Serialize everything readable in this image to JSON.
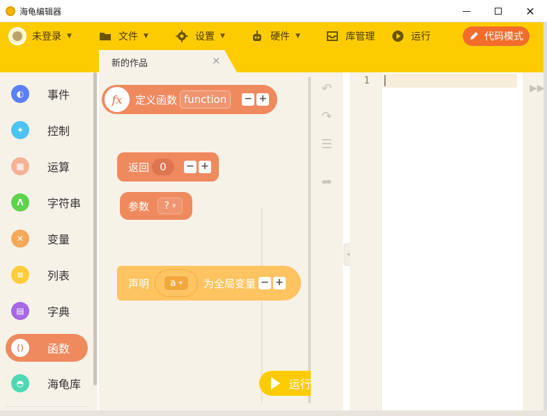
{
  "window": {
    "title": "海龟编辑器",
    "min_symbol": "",
    "close_symbol": "✕"
  },
  "menubar": {
    "user_label": "未登录",
    "file_label": "文件",
    "settings_label": "设置",
    "hardware_label": "硬件",
    "library_label": "库管理",
    "run_label": "运行",
    "code_mode_label": "代码模式"
  },
  "tab": {
    "label": "新的作品",
    "close": "×"
  },
  "sidebar": {
    "items": [
      {
        "label": "事件",
        "color": "#5b7ff7",
        "icon": "toggle-icon"
      },
      {
        "label": "控制",
        "color": "#4ec3f0",
        "icon": "gamepad-icon"
      },
      {
        "label": "运算",
        "color": "#f4b296",
        "icon": "calculator-icon"
      },
      {
        "label": "字符串",
        "color": "#5fd34f",
        "icon": "string-icon"
      },
      {
        "label": "变量",
        "color": "#f4a85a",
        "icon": "variable-icon"
      },
      {
        "label": "列表",
        "color": "#fdcc3a",
        "icon": "list-icon"
      },
      {
        "label": "字典",
        "color": "#a768e3",
        "icon": "book-icon"
      },
      {
        "label": "函数",
        "color": "#ef8a5f",
        "icon": "function-icon",
        "active": true
      },
      {
        "label": "海龟库",
        "color": "#4dd9b3",
        "icon": "turtle-icon"
      }
    ]
  },
  "blocks": {
    "define": {
      "fx": "fx",
      "label": "定义函数",
      "name": "function",
      "minus": "−",
      "plus": "+"
    },
    "return": {
      "label": "返回",
      "value": "0",
      "minus": "−",
      "plus": "+"
    },
    "param": {
      "label": "参数",
      "value": "?"
    },
    "declare": {
      "label": "声明",
      "var": "a",
      "suffix": "为全局变量",
      "minus": "−",
      "plus": "+"
    }
  },
  "run_button": {
    "label": "运行"
  },
  "editor": {
    "line_number": "1",
    "splitter": "◂▸"
  },
  "colors": {
    "brand": "#fdcc00",
    "function_block": "#ef8a5f",
    "variable_block": "#fdc461",
    "code_mode": "#f26c2b"
  }
}
